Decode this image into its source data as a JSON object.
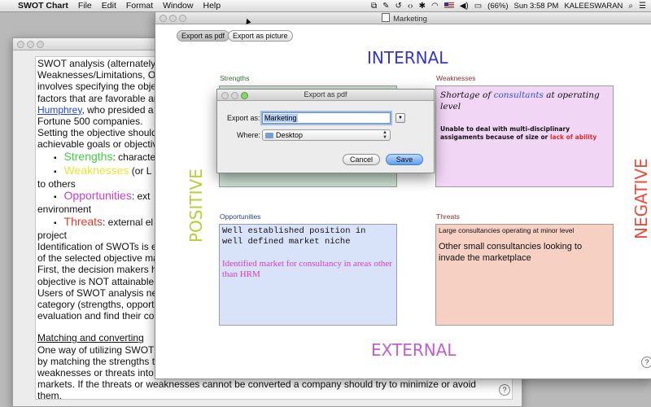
{
  "menubar": {
    "app_name": "SWOT Chart",
    "menus": [
      "File",
      "Edit",
      "Format",
      "Window",
      "Help"
    ],
    "battery": "(66%)",
    "clock": "Sun 3:58 PM",
    "user": "KALEESWARAN"
  },
  "doc": {
    "lines": [
      "SWOT analysis (alternately S",
      "Weaknesses/Limitations, Opp",
      "involves specifying the objec",
      "factors that are favorable and",
      "Humphrey",
      ", who presided a co",
      "Fortune 500 companies.",
      "Setting the objective should b",
      "achievable goals or objective",
      "Strengths",
      ": characte",
      "Weaknesses",
      " (or L",
      "to others",
      "Opportunities",
      ": ext",
      "environment",
      "Threats",
      ": external el",
      "project",
      "Identification of SWOTs is ess",
      "of the selected objective may",
      "First, the decision makers hav",
      "objective is NOT attainable a",
      "Users of SWOT analysis nee",
      "category (strengths, opportun",
      "evaluation and find their comp",
      "Matching and converting",
      "One way of utilizing SWOT is",
      "by matching the strengths to",
      "weaknesses or threats into st",
      "markets. If the threats or weaknesses cannot be converted a company should try to minimize or avoid",
      "them."
    ],
    "colors": {
      "strengths": "#3ecf3e",
      "weaknesses": "#e6e630",
      "opportunities": "#c83cd8",
      "threats": "#e23a2a"
    }
  },
  "main_window": {
    "title": "Marketing",
    "export_pdf": "Export as pdf",
    "export_picture": "Export as picture",
    "internal": "INTERNAL",
    "external": "EXTERNAL",
    "positive": "POSITIVE",
    "negative": "NEGATIVE",
    "strengths": {
      "label": "Strengths",
      "label_color": "#2f6e2f"
    },
    "weaknesses": {
      "label": "Weaknesses",
      "label_color": "#8a2d2d",
      "text_a": "Shortage of ",
      "text_hl": "consultants",
      "text_b": " at operating level",
      "sub_a": "Unable to deal with multi-disciplinary assigaments because of size or ",
      "sub_red": "lack of ability"
    },
    "opportunities": {
      "label": "Opportunities",
      "label_color": "#2b3f8f",
      "line1": "Well established position in",
      "line2": "well defined market niche",
      "sub": "Identified market for consultancy in areas other than HRM"
    },
    "threats": {
      "label": "Threats",
      "label_color": "#8a2d2d",
      "small": "Large consultancies operating at minor level",
      "main": "Other small consultancies looking to invade the marketplace"
    },
    "help": "?"
  },
  "dialog": {
    "title": "Export as pdf",
    "export_as_label": "Export as:",
    "export_as_value": "Marketing",
    "where_label": "Where:",
    "where_value": "Desktop",
    "cancel": "Cancel",
    "save": "Save"
  }
}
